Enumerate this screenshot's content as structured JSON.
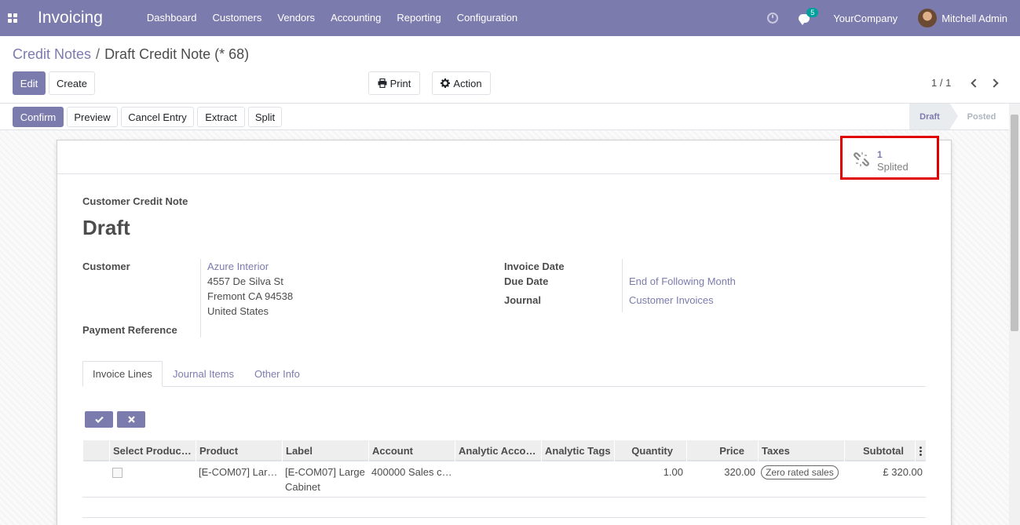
{
  "navbar": {
    "app_title": "Invoicing",
    "menu": [
      "Dashboard",
      "Customers",
      "Vendors",
      "Accounting",
      "Reporting",
      "Configuration"
    ],
    "chat_count": "5",
    "company": "YourCompany",
    "user": "Mitchell Admin"
  },
  "breadcrumb": {
    "parent": "Credit Notes",
    "separator": "/",
    "current": "Draft Credit Note (* 68)"
  },
  "controls": {
    "edit": "Edit",
    "create": "Create",
    "print": "Print",
    "action": "Action",
    "pager": "1 / 1"
  },
  "statusbar": {
    "buttons": [
      "Confirm",
      "Preview",
      "Cancel Entry",
      "Extract",
      "Split"
    ],
    "stages": {
      "draft": "Draft",
      "posted": "Posted"
    }
  },
  "smart_button": {
    "count": "1",
    "label": "Splited",
    "icon": "unlink-icon"
  },
  "form": {
    "type": "Customer Credit Note",
    "name": "Draft",
    "customer_label": "Customer",
    "customer_name": "Azure Interior",
    "customer_addr1": "4557 De Silva St",
    "customer_addr2": "Fremont CA 94538",
    "customer_addr3": "United States",
    "payment_ref_label": "Payment Reference",
    "invoice_date_label": "Invoice Date",
    "due_date_label": "Due Date",
    "due_date_value": "End of Following Month",
    "journal_label": "Journal",
    "journal_value": "Customer Invoices"
  },
  "tabs": [
    "Invoice Lines",
    "Journal Items",
    "Other Info"
  ],
  "table": {
    "headers": [
      "Select Produc…",
      "Product",
      "Label",
      "Account",
      "Analytic Acco…",
      "Analytic Tags",
      "Quantity",
      "Price",
      "Taxes",
      "Subtotal"
    ],
    "rows": [
      {
        "product": "[E-COM07] Lar…",
        "label_line1": "[E-COM07] Large",
        "label_line2": "Cabinet",
        "account": "400000 Sales c…",
        "quantity": "1.00",
        "price": "320.00",
        "tax": "Zero rated sales",
        "subtotal": "£ 320.00"
      }
    ]
  },
  "colors": {
    "primary": "#7c7bad",
    "highlight": "#e00000"
  }
}
